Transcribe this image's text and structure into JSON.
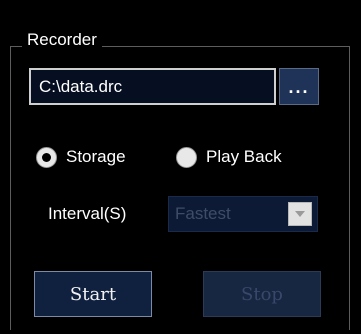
{
  "recorder": {
    "title": "Recorder",
    "path_value": "C:\\data.drc",
    "browse_label": "...",
    "mode": {
      "storage_label": "Storage",
      "playback_label": "Play Back",
      "selected": "Storage"
    },
    "interval": {
      "label": "Interval(S)",
      "selected_value": "Fastest",
      "enabled": false
    },
    "start_label": "Start",
    "stop_label": "Stop",
    "stop_enabled": false
  },
  "colors": {
    "background": "#000000",
    "input_background": "#060f22",
    "button_background": "#10213f",
    "disabled_text": "#39486a"
  }
}
